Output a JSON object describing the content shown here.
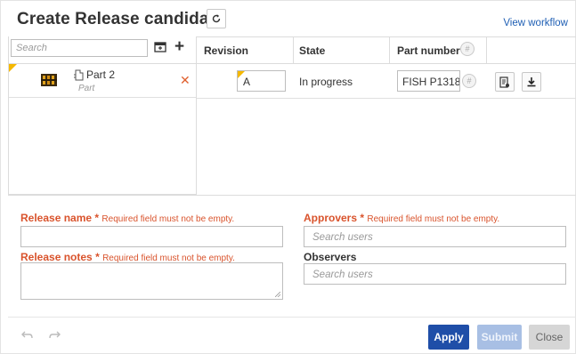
{
  "dialog": {
    "title": "Create Release candidate",
    "view_workflow_link": "View workflow"
  },
  "left_panel": {
    "search_placeholder": "Search",
    "items": [
      {
        "name": "Part 2",
        "type": "Part"
      }
    ]
  },
  "table": {
    "headers": {
      "revision": "Revision",
      "state": "State",
      "part_number": "Part number"
    },
    "rows": [
      {
        "revision": "A",
        "state": "In progress",
        "part_number": "FISH P1318"
      }
    ],
    "hash_symbol": "#"
  },
  "form": {
    "release_name": {
      "label": "Release name",
      "required_star": "*",
      "error": "Required field must not be empty.",
      "value": ""
    },
    "release_notes": {
      "label": "Release notes",
      "required_star": "*",
      "error": "Required field must not be empty.",
      "value": ""
    },
    "approvers": {
      "label": "Approvers",
      "required_star": "*",
      "error": "Required field must not be empty.",
      "placeholder": "Search users"
    },
    "observers": {
      "label": "Observers",
      "placeholder": "Search users"
    }
  },
  "footer": {
    "apply_label": "Apply",
    "submit_label": "Submit",
    "close_label": "Close"
  },
  "colors": {
    "accent": "#1f4ea8",
    "error": "#d9532c",
    "link": "#1f5fb4",
    "marker": "#f5b800"
  },
  "icons": [
    "refresh-icon",
    "new-folder-icon",
    "add-icon",
    "part-thumbnail-icon",
    "part-icon",
    "remove-icon",
    "hash-icon",
    "properties-icon",
    "download-icon",
    "undo-icon",
    "redo-icon",
    "resize-grip-icon"
  ]
}
